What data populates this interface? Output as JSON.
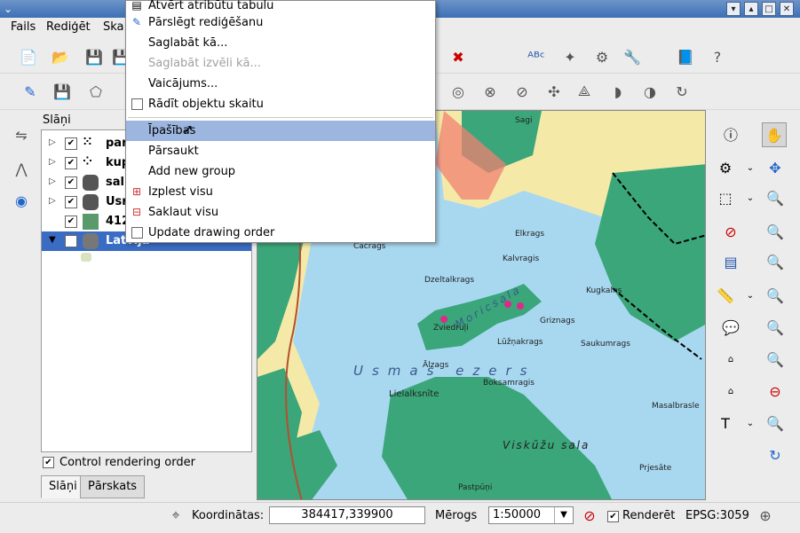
{
  "window": {
    "title": "d"
  },
  "menubar": {
    "items": [
      "Fails",
      "Rediģēt",
      "Ska"
    ]
  },
  "layers": {
    "title": "Slāņi",
    "items": [
      {
        "name": "par",
        "checked": true
      },
      {
        "name": "kup",
        "checked": true
      },
      {
        "name": "sal",
        "checked": true
      },
      {
        "name": "Usr",
        "checked": true
      },
      {
        "name": "412",
        "checked": true
      },
      {
        "name": "Latvija",
        "checked": true
      }
    ]
  },
  "control_rendering": {
    "label": "Control rendering order",
    "checked": true
  },
  "tabs": [
    "Slāņi",
    "Pārskats"
  ],
  "context_menu": {
    "items": [
      {
        "label": "Atvērt atribūtu tabulu",
        "icon": "table-icon"
      },
      {
        "label": "Pārslēgt rediģēšanu",
        "icon": "pencil-icon"
      },
      {
        "label": "Saglabāt kā..."
      },
      {
        "label": "Saglabāt izvēli kā...",
        "disabled": true
      },
      {
        "label": "Vaicājums..."
      },
      {
        "label": "Rādīt objektu skaitu",
        "checkbox": true
      },
      {
        "label": "Īpašības",
        "highlighted": true
      },
      {
        "label": "Pārsaukt"
      },
      {
        "label": "Add new group"
      },
      {
        "label": "Izplest visu",
        "icon": "expand-icon"
      },
      {
        "label": "Saklaut visu",
        "icon": "collapse-icon"
      },
      {
        "label": "Update drawing order",
        "checkbox": true
      }
    ]
  },
  "map": {
    "lake_label": "Usmas ezers",
    "island_label": "Moricsala",
    "south_label": "Viskūžu sala",
    "labels": [
      "Čačraģs",
      "Dzeltalkrags",
      "Kalvragis",
      "Zviedruļi",
      "Lielalksnīte",
      "Ālzags",
      "Lūžņakrags",
      "Griznags",
      "Saukumrags",
      "Kugkalns",
      "Boksamragis",
      "Pastpūņi",
      "Prjesāte",
      "Sagi",
      "Elkrags",
      "Masalbrasle"
    ]
  },
  "status": {
    "coord_label": "Koordinātas:",
    "coord_value": "384417,339900",
    "scale_label": "Mērogs",
    "scale_value": "1:50000",
    "render_label": "Renderēt",
    "render_checked": true,
    "epsg": "EPSG:3059"
  }
}
